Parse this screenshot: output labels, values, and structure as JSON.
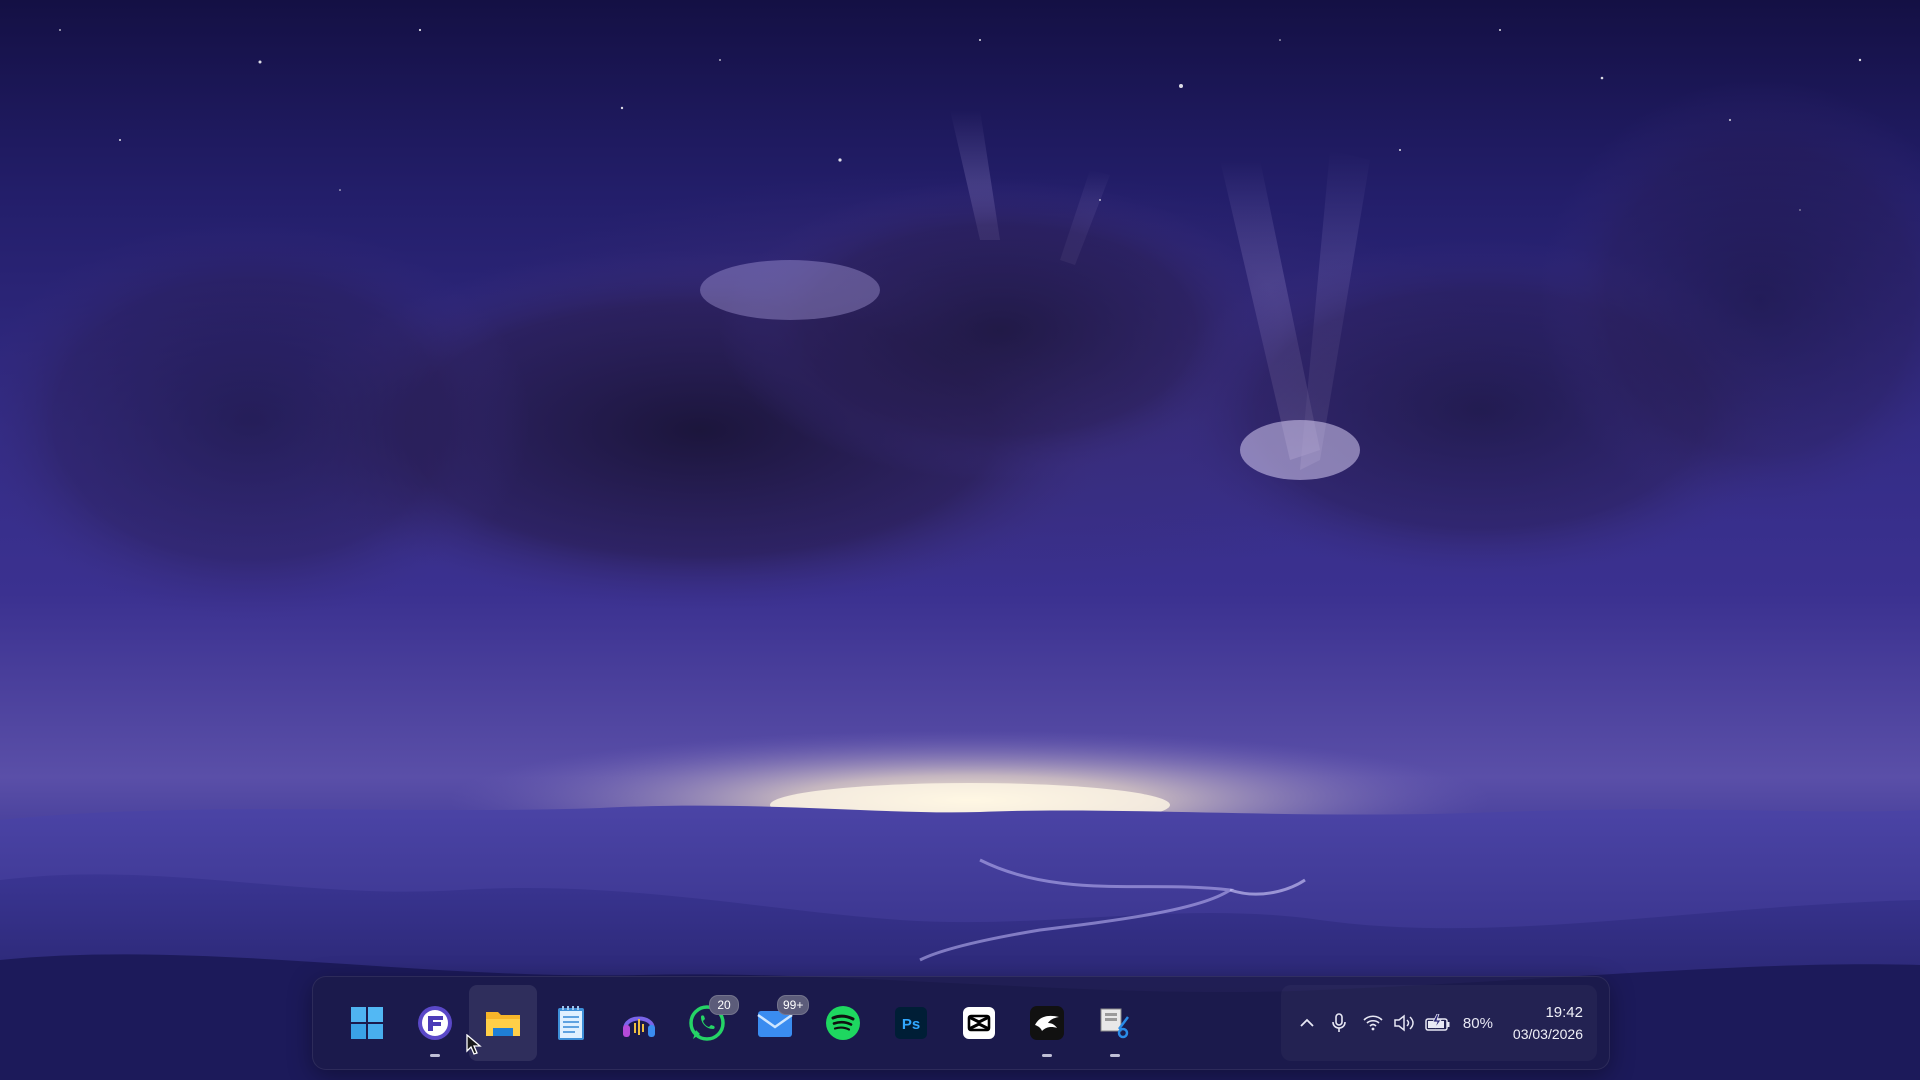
{
  "desktop": {
    "wallpaper": "night-sky-clouds-mountains"
  },
  "colors": {
    "taskbar_bg": "#1c1a46",
    "accent_windows": "#4fb3f0",
    "whatsapp": "#25d366",
    "spotify": "#1ed760",
    "photoshop": "#31a8ff"
  },
  "taskbar": {
    "apps": [
      {
        "name": "Start",
        "icon": "windows-start-icon",
        "running": false
      },
      {
        "name": "Browser",
        "icon": "f-browser-icon",
        "running": true
      },
      {
        "name": "File Explorer",
        "icon": "folder-icon",
        "running": false,
        "hovered": true
      },
      {
        "name": "Notepad",
        "icon": "notepad-icon",
        "running": false
      },
      {
        "name": "Audio App",
        "icon": "headphones-icon",
        "running": false
      },
      {
        "name": "WhatsApp",
        "icon": "whatsapp-icon",
        "running": false,
        "badge": "20"
      },
      {
        "name": "Mail",
        "icon": "mail-icon",
        "running": false,
        "badge": "99+"
      },
      {
        "name": "Spotify",
        "icon": "spotify-icon",
        "running": false
      },
      {
        "name": "Photoshop",
        "icon": "photoshop-icon",
        "running": false,
        "label": "Ps"
      },
      {
        "name": "CapCut",
        "icon": "capcut-icon",
        "running": false
      },
      {
        "name": "Eagle App",
        "icon": "eagle-icon",
        "running": true
      },
      {
        "name": "Snipping Tool",
        "icon": "snipping-tool-icon",
        "running": true
      }
    ]
  },
  "tray": {
    "overflow_icon": "chevron-up-icon",
    "mic_icon": "microphone-icon",
    "wifi_icon": "wifi-icon",
    "volume_icon": "speaker-icon",
    "battery_icon": "battery-charging-icon",
    "battery_percent": "80%",
    "time": "19:42",
    "date": "03/03/2026"
  }
}
